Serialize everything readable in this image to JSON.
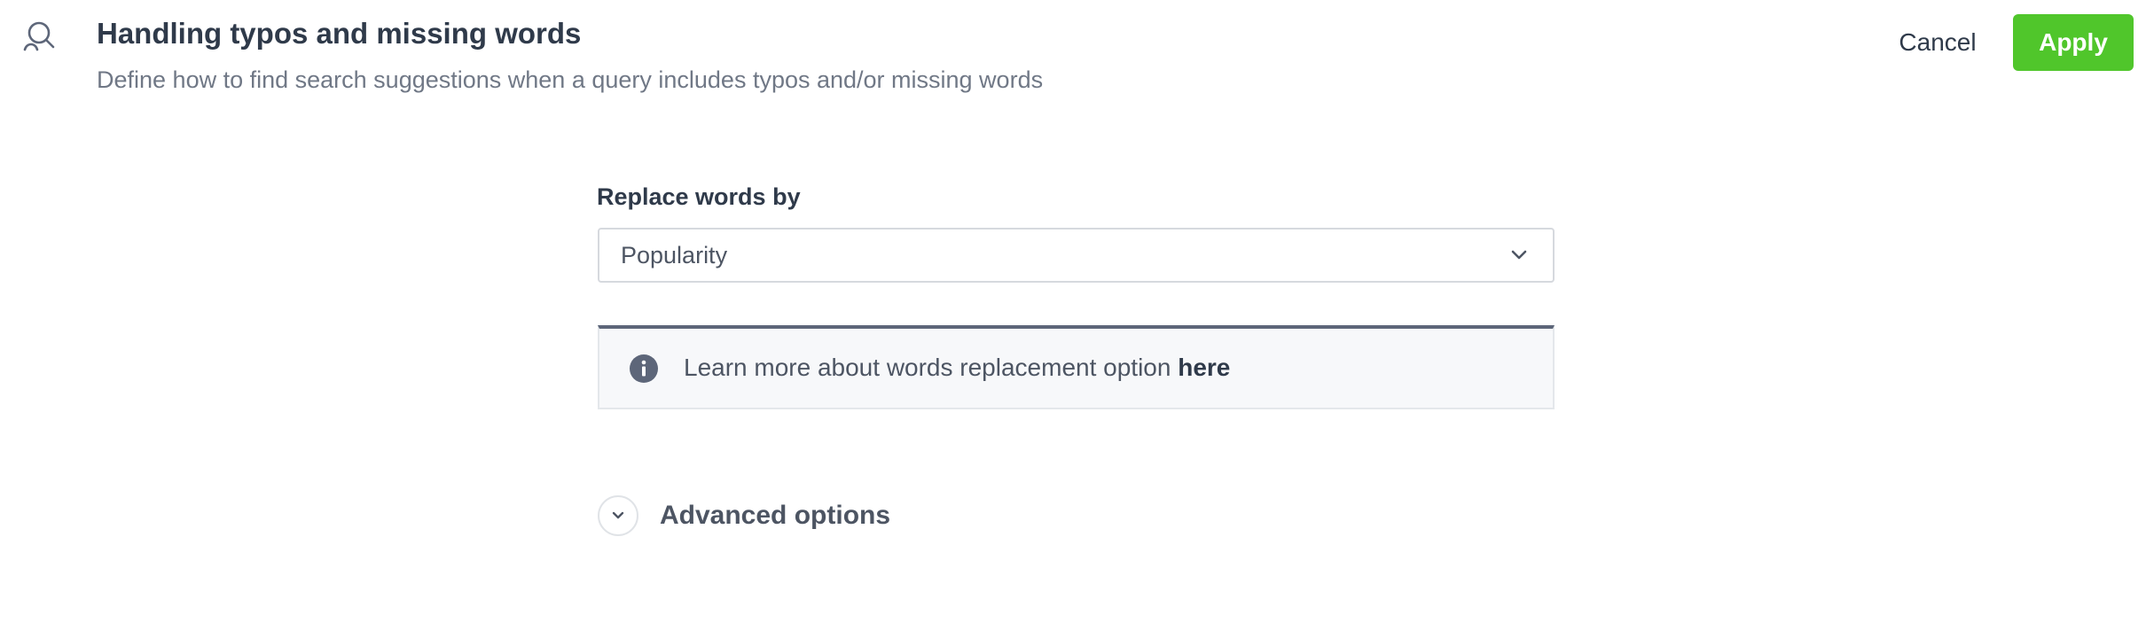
{
  "header": {
    "icon": "search-person-icon",
    "title": "Handling typos and missing words",
    "subtitle": "Define how to find search suggestions when a query includes typos and/or missing words"
  },
  "actions": {
    "cancel_label": "Cancel",
    "apply_label": "Apply",
    "apply_color": "#50c62b"
  },
  "replace_field": {
    "label": "Replace words by",
    "selected_value": "Popularity",
    "chevron_icon": "chevron-down-icon"
  },
  "info": {
    "icon": "info-icon",
    "text": "Learn more about words replacement option",
    "link_text": "here"
  },
  "advanced": {
    "icon": "chevron-down-icon",
    "label": "Advanced options"
  }
}
